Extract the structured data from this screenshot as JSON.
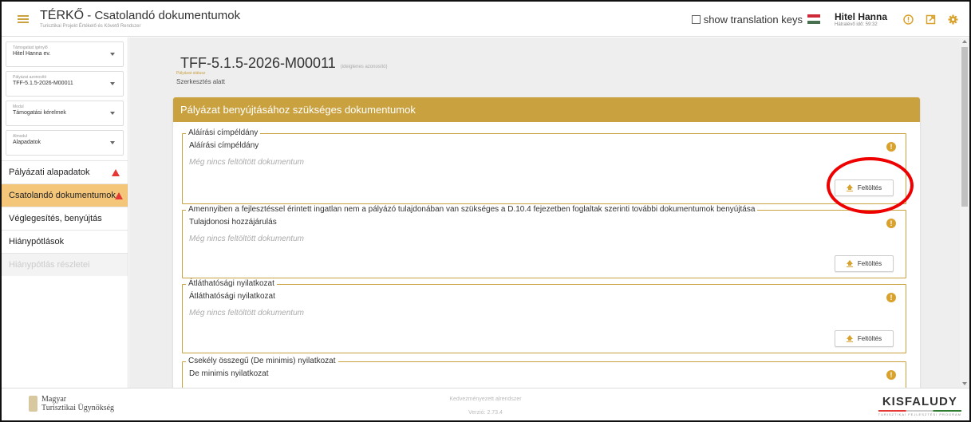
{
  "header": {
    "app_name": "TÉRKŐ",
    "page_title": " - Csatolandó dokumentumok",
    "subtitle": "Turisztikai Projekt Értékelő és Követő Rendszer",
    "translation_keys_label": "show translation keys",
    "user_name": "Hitel Hanna",
    "time_left": "Hátralévő idő: 59:32"
  },
  "sidebar": {
    "selects": [
      {
        "label": "Támogatást igénylő",
        "value": "Hitel Hanna ev."
      },
      {
        "label": "Pályázat azonosító",
        "value": "TFF-5.1.5-2026-M00011"
      },
      {
        "label": "Modul",
        "value": "Támogatási kérelmek"
      },
      {
        "label": "Almodul",
        "value": "Alapadatok"
      }
    ],
    "nav": [
      {
        "label": "Pályázati alapadatok",
        "warning": true
      },
      {
        "label": "Csatolandó dokumentumok",
        "warning": true
      },
      {
        "label": "Véglegesítés, benyújtás"
      },
      {
        "label": "Hiánypótlások"
      },
      {
        "label": "Hiánypótlás részletei"
      }
    ]
  },
  "main": {
    "application_id": "TFF-5.1.5-2026-M00011",
    "id_note": "(ideiglenes azonosító)",
    "status_label": "Pályázat státusz",
    "status_value": "Szerkesztés alatt",
    "card_title": "Pályázat benyújtásához szükséges dokumentumok",
    "sections": [
      {
        "legend": "Aláírási címpéldány",
        "doc_name": "Aláírási címpéldány",
        "empty_text": "Még nincs feltöltött dokumentum",
        "button": "Feltöltés"
      },
      {
        "legend": "Amennyiben a fejlesztéssel érintett ingatlan nem a pályázó tulajdonában van szükséges a D.10.4 fejezetben foglaltak szerinti további dokumentumok benyújtása",
        "doc_name": "Tulajdonosi hozzájárulás",
        "empty_text": "Még nincs feltöltött dokumentum",
        "button": "Feltöltés"
      },
      {
        "legend": "Átláthatósági nyilatkozat",
        "doc_name": "Átláthatósági nyilatkozat",
        "empty_text": "Még nincs feltöltött dokumentum",
        "button": "Feltöltés"
      },
      {
        "legend": "Csekély összegű (De minimis) nyilatkozat",
        "doc_name": "De minimis nyilatkozat"
      }
    ]
  },
  "footer": {
    "org_line1": "Magyar",
    "org_line2": "Turisztikai Ügynökség",
    "center1": "Kedvezményezett alrendszer",
    "center2": "Verzió: 2.73.4",
    "brand": "KISFALUDY",
    "brand_sub": "TURISZTIKAI FEJLESZTÉSI PROGRAM"
  },
  "colors": {
    "accent": "#c9a13f",
    "active_nav": "#f3c67a",
    "warning": "#e53935",
    "highlight_ring": "#e00000"
  }
}
